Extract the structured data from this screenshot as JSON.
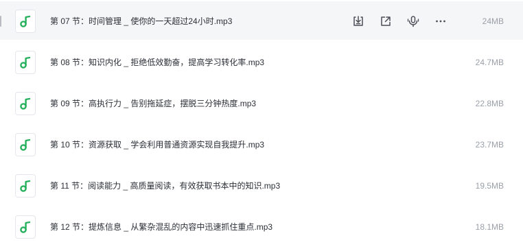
{
  "files": [
    {
      "name": "第 07 节：时间管理 _ 使你的一天超过24小时.mp3",
      "size": "24MB",
      "hovered": true
    },
    {
      "name": "第 08 节：知识内化 _ 拒绝低效勤奋，提高学习转化率.mp3",
      "size": "24.7MB"
    },
    {
      "name": "第 09 节：高执行力 _ 告别拖延症，摆脱三分钟热度.mp3",
      "size": "22.8MB"
    },
    {
      "name": "第 10 节：资源获取 _ 学会利用普通资源实现自我提升.mp3",
      "size": "23.7MB"
    },
    {
      "name": "第 11 节：阅读能力 _ 高质量阅读，有效获取书本中的知识.mp3",
      "size": "19.5MB"
    },
    {
      "name": "第 12 节：提炼信息 _ 从繁杂混乱的内容中迅速抓住重点.mp3",
      "size": "18.1MB"
    }
  ],
  "row_actions": [
    {
      "icon": "download-icon"
    },
    {
      "icon": "share-icon"
    },
    {
      "icon": "transcribe-icon"
    },
    {
      "icon": "more-icon"
    }
  ],
  "colors": {
    "audio_icon": "#27b05d",
    "action_icon": "#4a4f57",
    "hover_bg": "#f5f6f7"
  }
}
